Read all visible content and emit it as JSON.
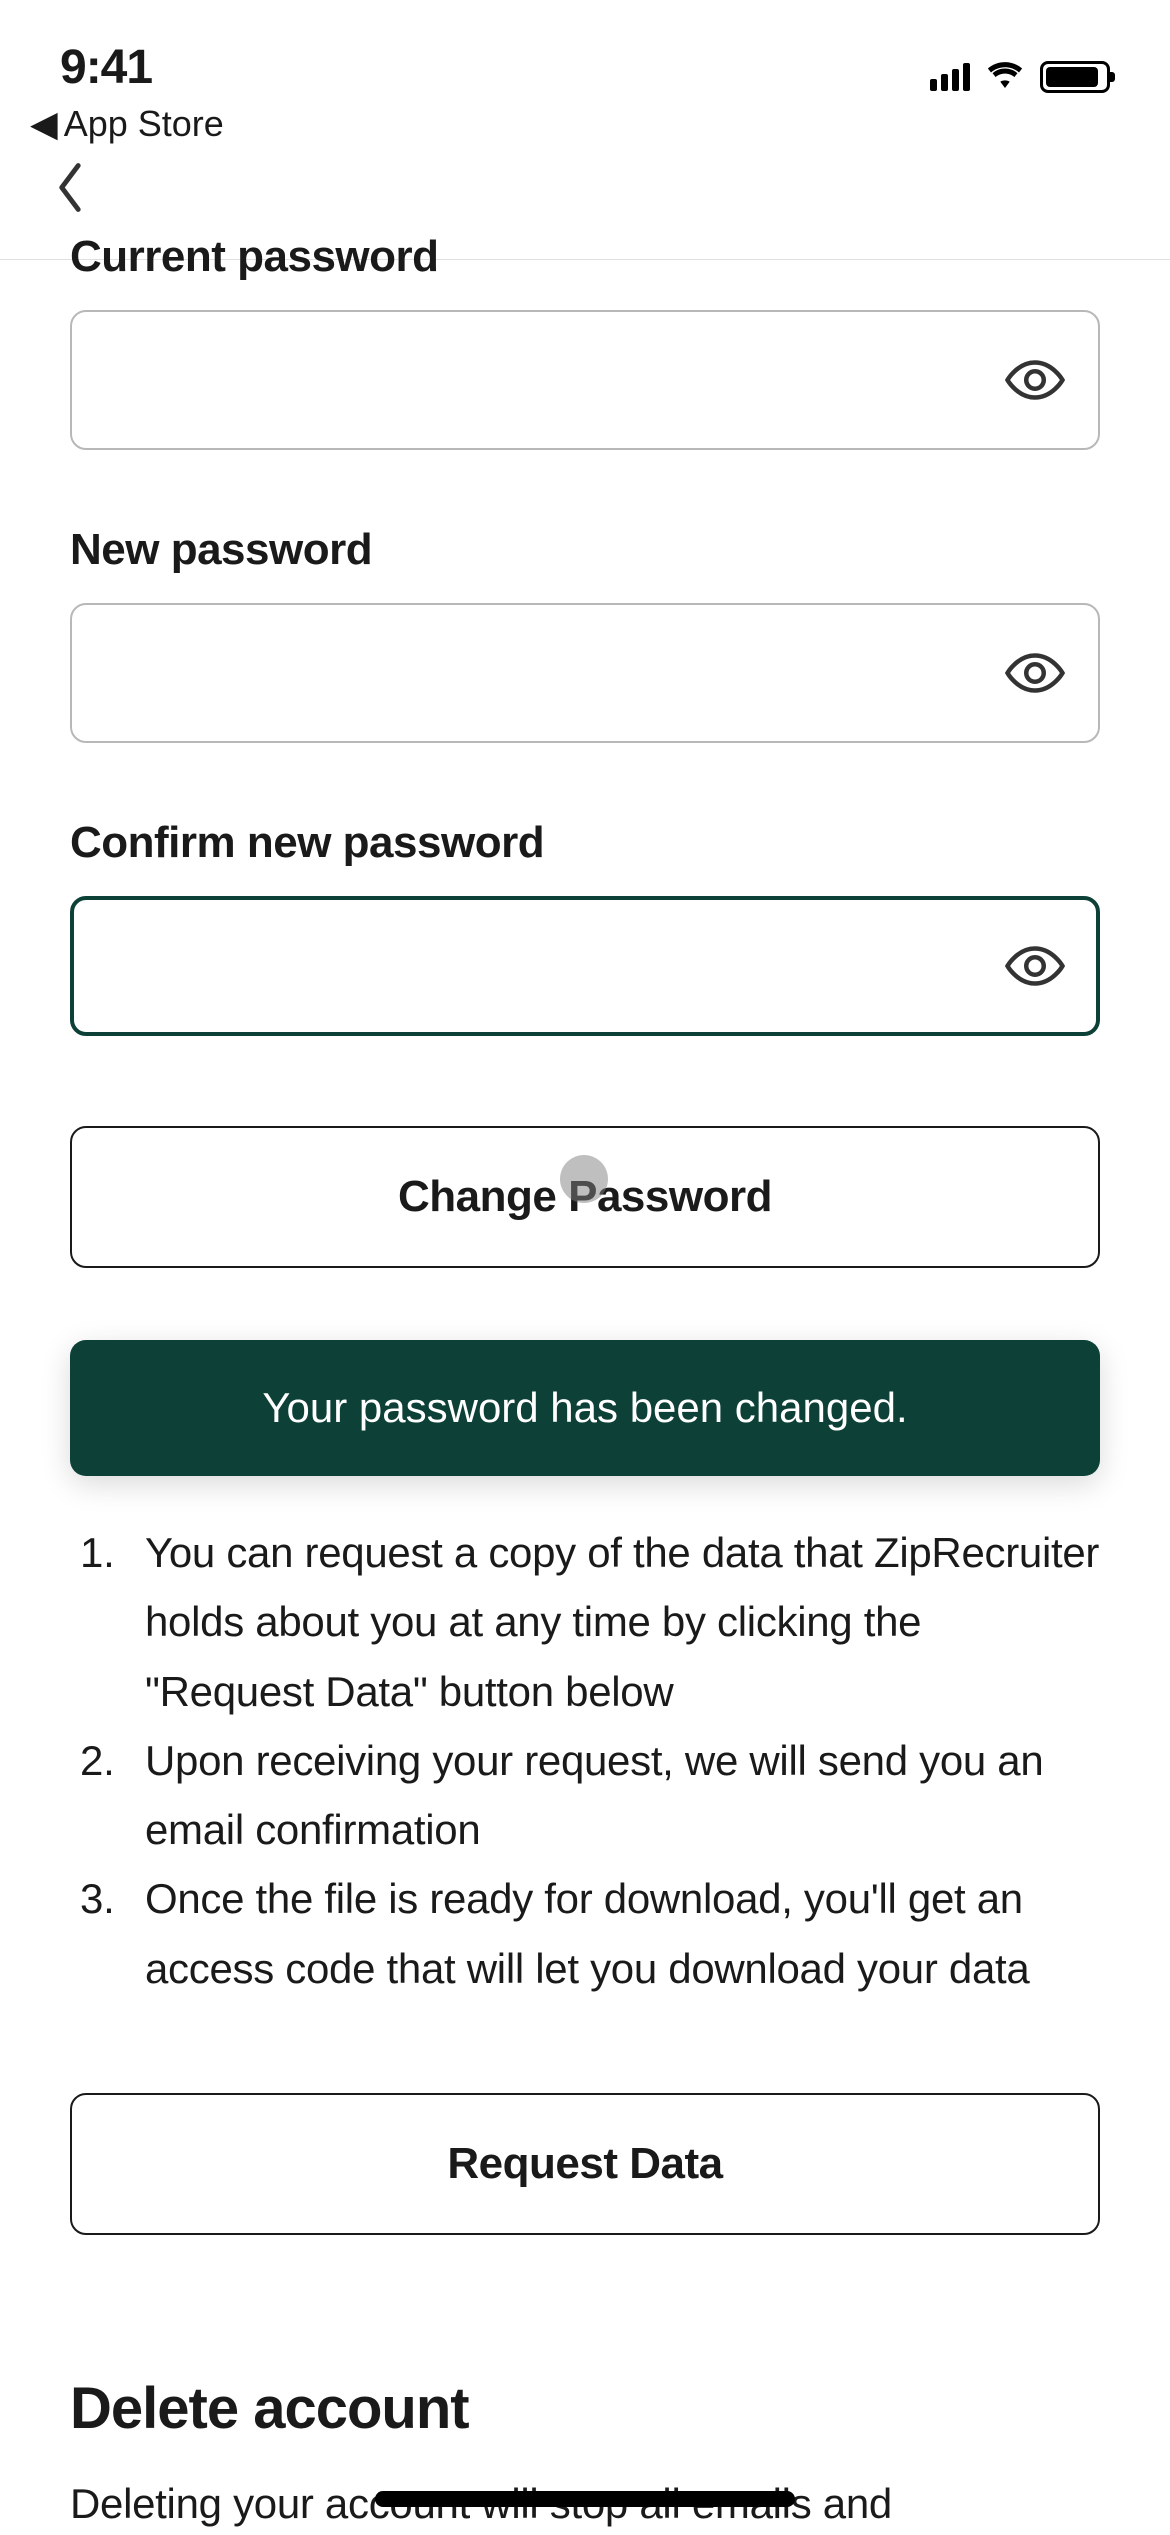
{
  "status_bar": {
    "time": "9:41",
    "back_app_label": "App Store"
  },
  "password_section": {
    "current_label": "Current password",
    "new_label": "New password",
    "confirm_label": "Confirm new password",
    "change_button_label": "Change Password"
  },
  "toast": {
    "message": "Your password has been changed."
  },
  "data_section": {
    "steps": [
      "You can request a copy of the data that ZipRecruiter holds about you at any time by clicking the \"Request Data\" button below",
      "Upon receiving your request, we will send you an email confirmation",
      "Once the file is ready for download, you'll get an access code that will let you download your data"
    ],
    "request_button_label": "Request Data"
  },
  "delete_section": {
    "heading": "Delete account",
    "body_partial": "Deleting your account will stop all emails and"
  }
}
